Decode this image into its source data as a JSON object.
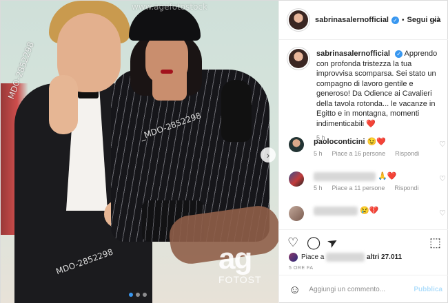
{
  "photo": {
    "watermarks": [
      "MDO-2852298",
      "_MDO-2852298",
      "MDO-2852298",
      "www.agefotostock"
    ],
    "agency_logo": "ag",
    "agency_text": "FOTOST",
    "carousel_next": "›"
  },
  "header": {
    "username": "sabrinasalernofficial",
    "verified_glyph": "✓",
    "separator": "•",
    "follow_label": "Segui già",
    "more_icon": "···"
  },
  "caption": {
    "username": "sabrinasalernofficial",
    "text": "Apprendo con profonda tristezza la tua improvvisa scomparsa. Sei stato un compagno di lavoro gentile e generoso! Da Odience ai Cavalieri della tavola rotonda... le vacanze in Egitto e in montagna, momenti indimenticabili ❤️",
    "time": "5 h"
  },
  "comments": [
    {
      "username": "paoloconticini",
      "text": "😉❤️",
      "time": "5 h",
      "likes": "Piace a 16 persone",
      "reply": "Rispondi"
    },
    {
      "username": "",
      "text": "🙏❤️",
      "time": "5 h",
      "likes": "Piace a 11 persone",
      "reply": "Rispondi"
    },
    {
      "username": "",
      "text": "😢💔",
      "time": "",
      "likes": "",
      "reply": ""
    }
  ],
  "actions": {
    "like_icon": "♡",
    "comment_icon": "◯",
    "share_icon": "➤",
    "save_icon": "⬚"
  },
  "likes": {
    "prefix": "Piace a",
    "suffix": "altri 27.011"
  },
  "post_time": "5 ORE FA",
  "add_comment": {
    "emoji_icon": "☺",
    "placeholder": "Aggiungi un commento...",
    "publish_label": "Pubblica"
  },
  "colors": {
    "accent": "#3897f0",
    "heart": "#ed4956",
    "muted": "#8e8e8e"
  }
}
